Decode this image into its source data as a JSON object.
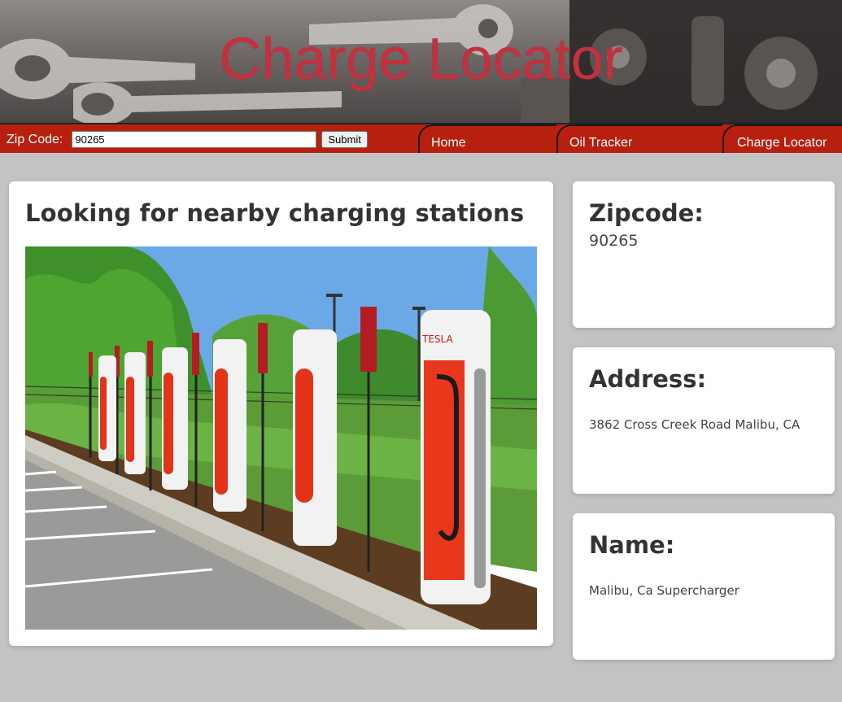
{
  "header": {
    "title": "Charge Locator"
  },
  "search": {
    "label": "Zip Code:",
    "value": "90265",
    "submit_label": "Submit"
  },
  "nav": {
    "tabs": [
      {
        "label": "Home"
      },
      {
        "label": "Oil Tracker"
      },
      {
        "label": "Charge Locator"
      }
    ]
  },
  "main": {
    "title": "Looking for nearby charging stations",
    "image": {
      "description_icon": "charging-stations-photo",
      "brand_text": "TESLA"
    }
  },
  "details": [
    {
      "heading": "Zipcode:",
      "value": "90265"
    },
    {
      "heading": "Address:",
      "value": "3862 Cross Creek Road Malibu, CA"
    },
    {
      "heading": "Name:",
      "value": "Malibu, Ca Supercharger"
    }
  ],
  "colors": {
    "accent_red": "#b7200f",
    "title_red": "#c3303f",
    "page_bg": "#c3c3c3",
    "card_bg": "#ffffff"
  }
}
